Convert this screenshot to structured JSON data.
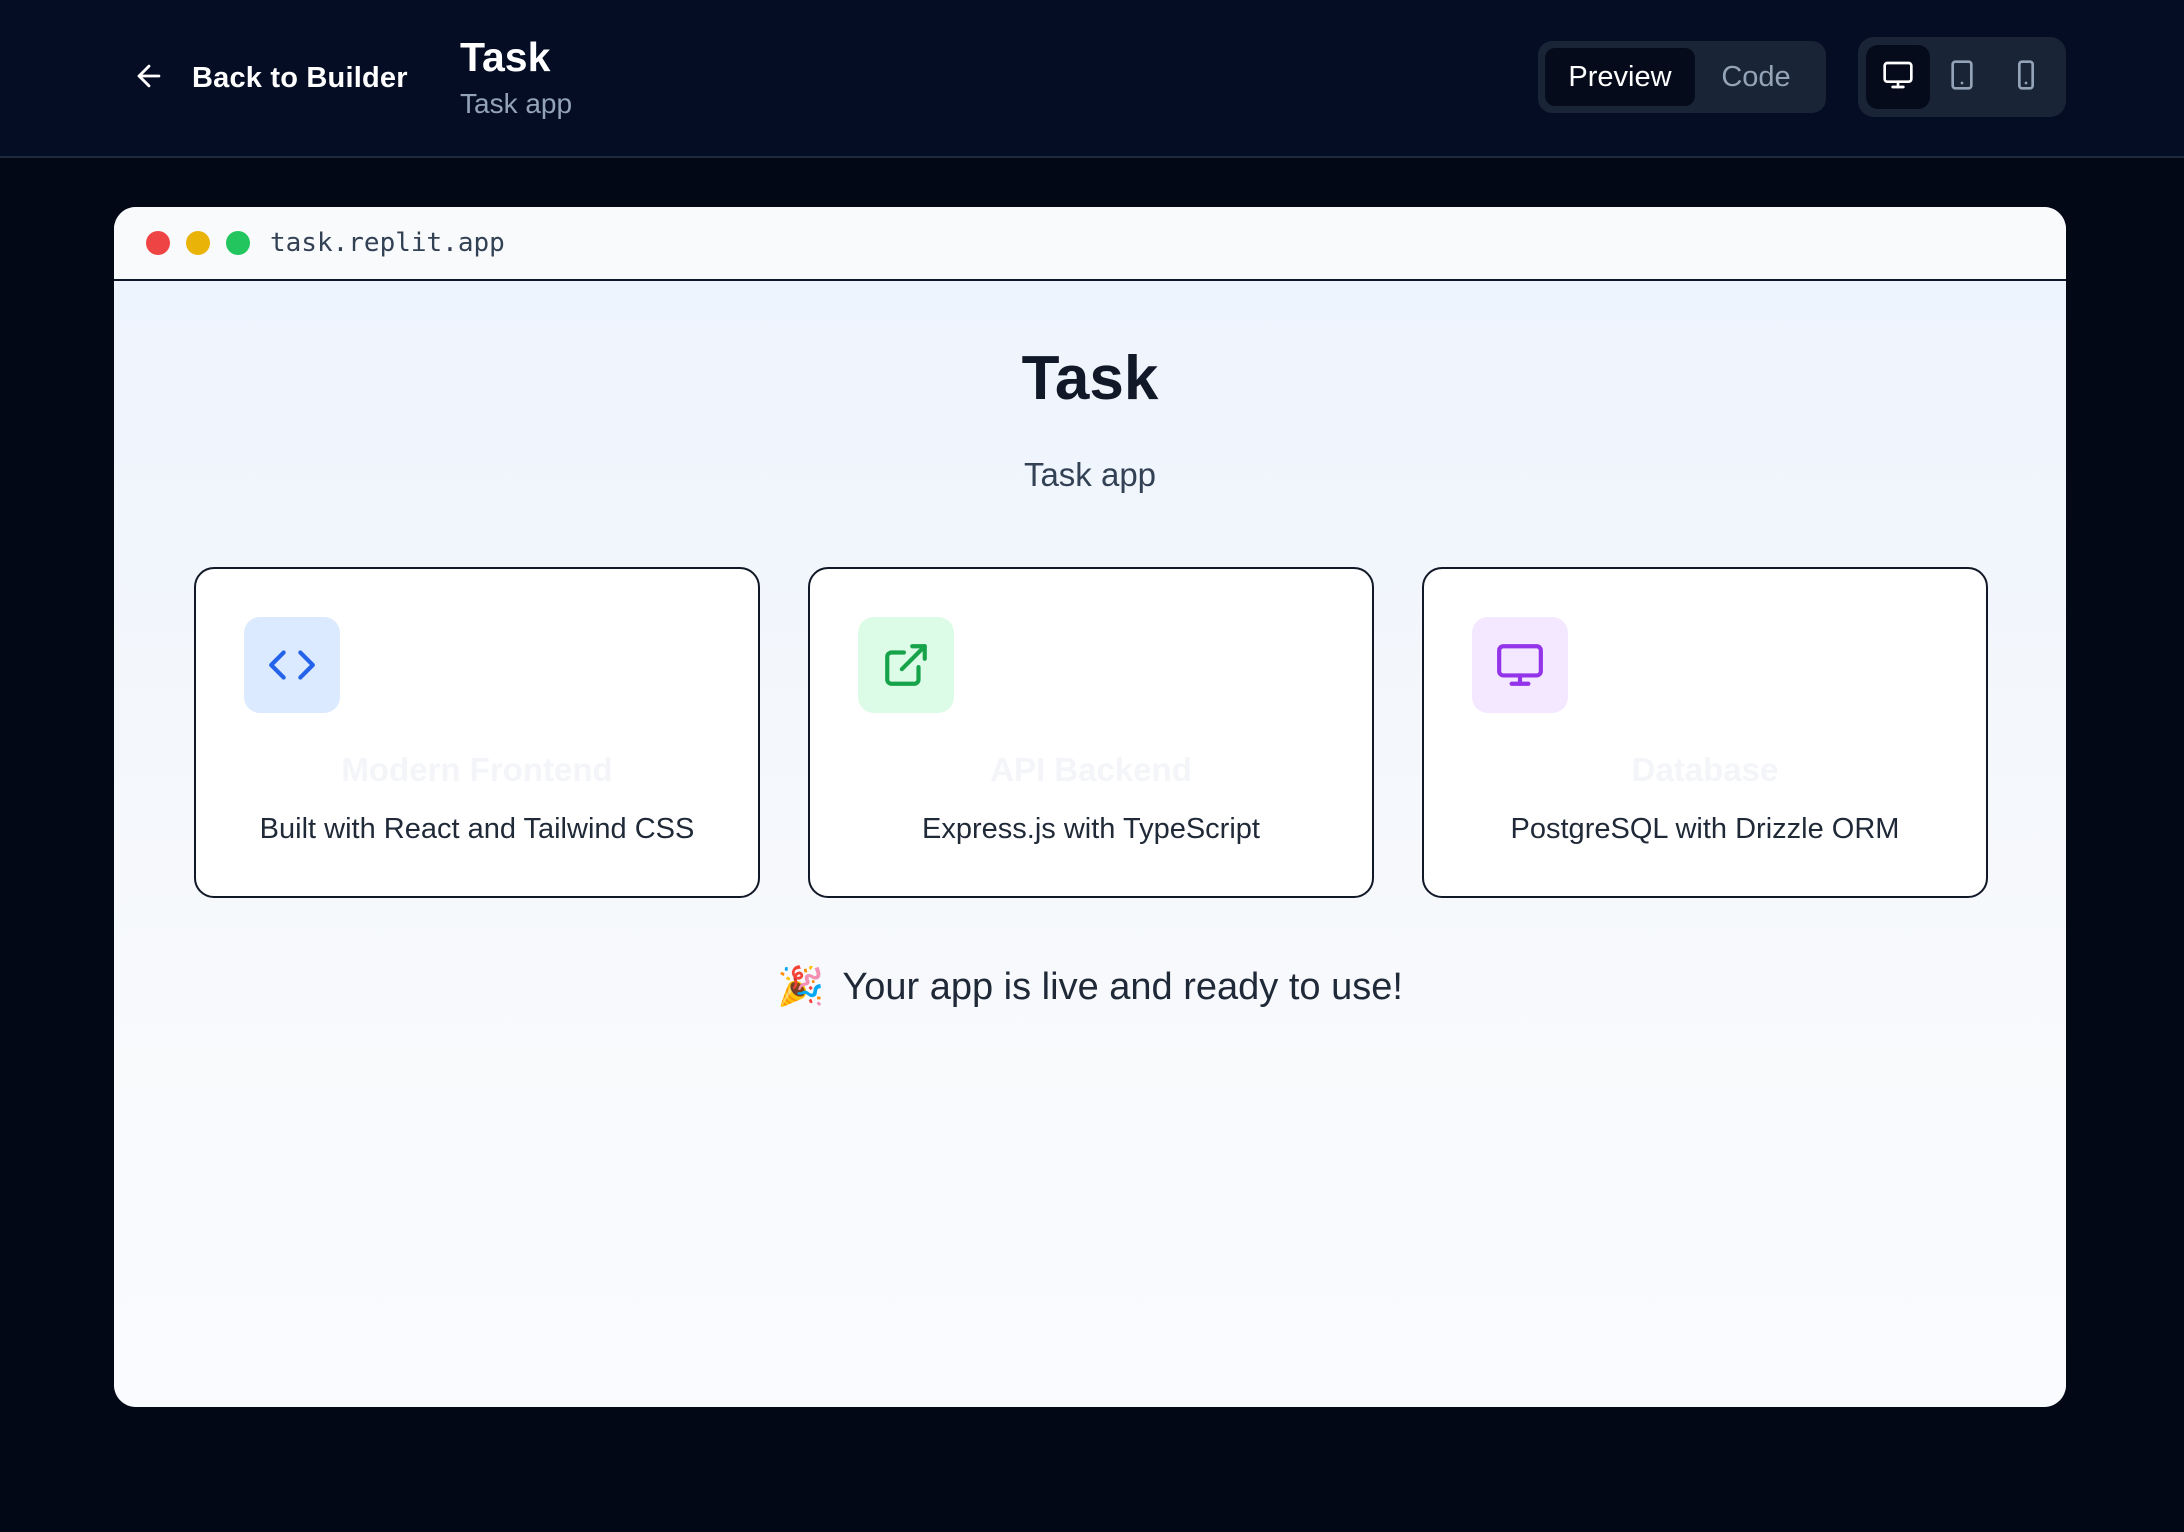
{
  "header": {
    "back_label": "Back to Builder",
    "title": "Task",
    "subtitle": "Task app",
    "modes": [
      {
        "label": "Preview",
        "active": true
      },
      {
        "label": "Code",
        "active": false
      }
    ],
    "devices": [
      {
        "icon": "monitor-icon",
        "active": true
      },
      {
        "icon": "tablet-icon",
        "active": false
      },
      {
        "icon": "smartphone-icon",
        "active": false
      }
    ]
  },
  "window": {
    "url": "task.replit.app",
    "traffic_lights": {
      "close": "#ef4444",
      "minimize": "#eab308",
      "maximize": "#22c55e"
    }
  },
  "app": {
    "title": "Task",
    "subtitle": "Task app",
    "features": [
      {
        "icon": "code-icon",
        "title": "Modern Frontend",
        "description": "Built with React and Tailwind CSS",
        "icon_color": "#2563eb",
        "icon_bg": "#dbeafe"
      },
      {
        "icon": "external-link-icon",
        "title": "API Backend",
        "description": "Express.js with TypeScript",
        "icon_color": "#16a34a",
        "icon_bg": "#dcfce7"
      },
      {
        "icon": "monitor-icon",
        "title": "Database",
        "description": "PostgreSQL with Drizzle ORM",
        "icon_color": "#9333ea",
        "icon_bg": "#f3e8ff"
      }
    ],
    "live_emoji": "🎉",
    "live_message": "Your app is live and ready to use!"
  }
}
